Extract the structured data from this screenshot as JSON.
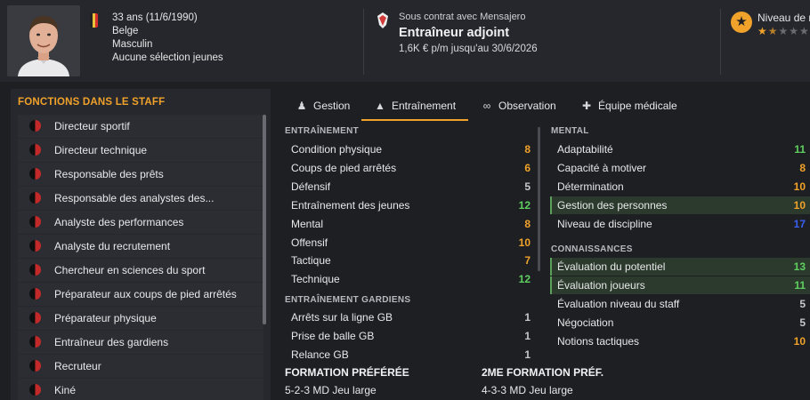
{
  "colors": {
    "accent": "#f0a22a",
    "green": "#5fcf5f",
    "gray": "#c8c8cc",
    "blue": "#3a5ff0",
    "highlight": "#2b3a2c"
  },
  "profile": {
    "age_line": "33 ans (11/6/1990)",
    "nationality": "Belge",
    "gender": "Masculin",
    "youth": "Aucune sélection jeunes"
  },
  "contract": {
    "line1": "Sous contrat avec Mensajero",
    "role": "Entraîneur adjoint",
    "salary": "1,6K € p/m jusqu'au 30/6/2026"
  },
  "reputation": {
    "label": "Niveau de r",
    "stars": 1.5,
    "max_stars": 5
  },
  "staff_panel": {
    "title": "FONCTIONS DANS LE STAFF",
    "items": [
      "Directeur sportif",
      "Directeur technique",
      "Responsable des prêts",
      "Responsable des analystes des...",
      "Analyste des performances",
      "Analyste du recrutement",
      "Chercheur en sciences du sport",
      "Préparateur aux coups de pied arrêtés",
      "Préparateur physique",
      "Entraîneur des gardiens",
      "Recruteur",
      "Kiné"
    ]
  },
  "tabs": [
    {
      "label": "Gestion",
      "icon": "person-icon"
    },
    {
      "label": "Entraînement",
      "icon": "cone-icon",
      "active": true
    },
    {
      "label": "Observation",
      "icon": "binoculars-icon"
    },
    {
      "label": "Équipe médicale",
      "icon": "medical-kit-icon"
    }
  ],
  "training": {
    "header": "ENTRAÎNEMENT",
    "rows": [
      {
        "name": "Condition physique",
        "value": "8",
        "color": "#f0a22a"
      },
      {
        "name": "Coups de pied arrêtés",
        "value": "6",
        "color": "#f0a22a"
      },
      {
        "name": "Défensif",
        "value": "5",
        "color": "#c8c8cc"
      },
      {
        "name": "Entraînement des jeunes",
        "value": "12",
        "color": "#5fcf5f"
      },
      {
        "name": "Mental",
        "value": "8",
        "color": "#f0a22a"
      },
      {
        "name": "Offensif",
        "value": "10",
        "color": "#f0a22a"
      },
      {
        "name": "Tactique",
        "value": "7",
        "color": "#f0a22a"
      },
      {
        "name": "Technique",
        "value": "12",
        "color": "#5fcf5f"
      }
    ]
  },
  "goalkeeping": {
    "header": "ENTRAÎNEMENT GARDIENS",
    "rows": [
      {
        "name": "Arrêts sur la ligne GB",
        "value": "1",
        "color": "#c8c8cc"
      },
      {
        "name": "Prise de balle GB",
        "value": "1",
        "color": "#c8c8cc"
      },
      {
        "name": "Relance GB",
        "value": "1",
        "color": "#c8c8cc"
      }
    ]
  },
  "mental": {
    "header": "MENTAL",
    "rows": [
      {
        "name": "Adaptabilité",
        "value": "11",
        "color": "#5fcf5f"
      },
      {
        "name": "Capacité à motiver",
        "value": "8",
        "color": "#f0a22a"
      },
      {
        "name": "Détermination",
        "value": "10",
        "color": "#f0a22a"
      },
      {
        "name": "Gestion des personnes",
        "value": "10",
        "color": "#f0a22a",
        "highlight": true
      },
      {
        "name": "Niveau de discipline",
        "value": "17",
        "color": "#3a5ff0"
      }
    ]
  },
  "knowledge": {
    "header": "CONNAISSANCES",
    "rows": [
      {
        "name": "Évaluation du potentiel",
        "value": "13",
        "color": "#5fcf5f",
        "highlight": true
      },
      {
        "name": "Évaluation joueurs",
        "value": "11",
        "color": "#5fcf5f",
        "highlight": true
      },
      {
        "name": "Évaluation niveau du staff",
        "value": "5",
        "color": "#c8c8cc"
      },
      {
        "name": "Négociation",
        "value": "5",
        "color": "#c8c8cc"
      },
      {
        "name": "Notions tactiques",
        "value": "10",
        "color": "#f0a22a"
      }
    ]
  },
  "formations": {
    "preferred_label": "FORMATION PRÉFÉRÉE",
    "preferred_value": "5-2-3 MD Jeu large",
    "second_label": "2ME FORMATION PRÉF.",
    "second_value": "4-3-3 MD Jeu large"
  }
}
